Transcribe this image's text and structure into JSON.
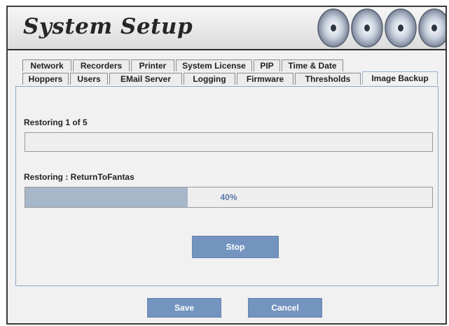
{
  "window": {
    "title": "System Setup"
  },
  "tabs": {
    "row1": [
      "Network",
      "Recorders",
      "Printer",
      "System License",
      "PIP",
      "Time & Date"
    ],
    "row2": [
      "Hoppers",
      "Users",
      "EMail Server",
      "Logging",
      "Firmware",
      "Thresholds",
      "Image Backup"
    ],
    "active": "Image Backup"
  },
  "restore": {
    "overall_label": "Restoring 1 of 5",
    "overall_progress": 0,
    "item_label": "Restoring : ReturnToFantas",
    "item_progress_percent": 40,
    "item_progress_text": "40%",
    "stop_label": "Stop"
  },
  "footer": {
    "save_label": "Save",
    "cancel_label": "Cancel"
  },
  "colors": {
    "button": "#7494c0",
    "progress_fill": "#a7b7ca",
    "panel_border": "#8fa6c8"
  }
}
